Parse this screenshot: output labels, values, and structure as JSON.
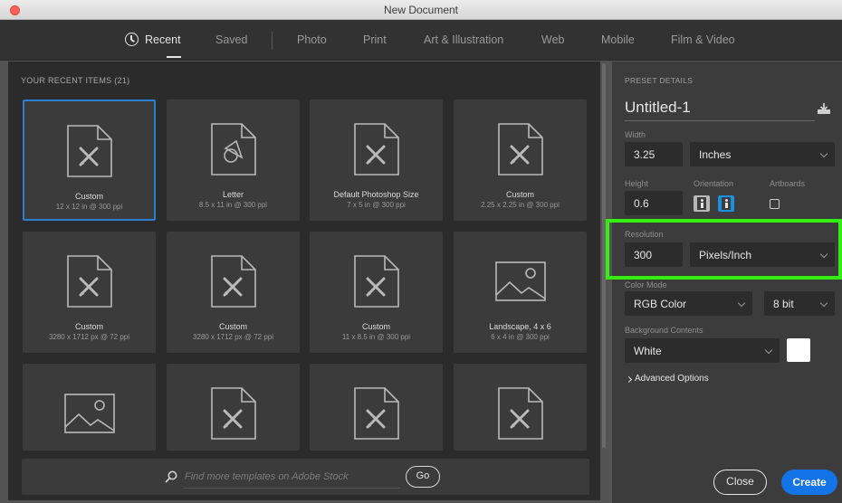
{
  "window": {
    "title": "New Document"
  },
  "nav": {
    "tabs": [
      {
        "label": "Recent",
        "active": true
      },
      {
        "label": "Saved"
      },
      {
        "label": "Photo"
      },
      {
        "label": "Print"
      },
      {
        "label": "Art & Illustration"
      },
      {
        "label": "Web"
      },
      {
        "label": "Mobile"
      },
      {
        "label": "Film & Video"
      }
    ]
  },
  "recent": {
    "heading": "YOUR RECENT ITEMS  (21)",
    "items": [
      {
        "name": "Custom",
        "desc": "12 x 12 in @ 300 ppi",
        "icon": "document-brush-icon",
        "selected": true
      },
      {
        "name": "Letter",
        "desc": "8.5 x 11 in @ 300 ppi",
        "icon": "document-shapes-icon"
      },
      {
        "name": "Default Photoshop Size",
        "desc": "7 x 5 in @ 300 ppi",
        "icon": "document-brush-icon"
      },
      {
        "name": "Custom",
        "desc": "2.25 x 2.25 in @ 300 ppi",
        "icon": "document-brush-icon"
      },
      {
        "name": "Custom",
        "desc": "3280 x 1712 px @ 72 ppi",
        "icon": "document-brush-icon"
      },
      {
        "name": "Custom",
        "desc": "3280 x 1712 px @ 72 ppi",
        "icon": "document-brush-icon"
      },
      {
        "name": "Custom",
        "desc": "11 x 8.5 in @ 300 ppi",
        "icon": "document-brush-icon"
      },
      {
        "name": "Landscape, 4 x 6",
        "desc": "6 x 4 in @ 300 ppi",
        "icon": "landscape-image-icon"
      },
      {
        "name": "",
        "desc": "",
        "icon": "landscape-image-icon"
      },
      {
        "name": "",
        "desc": "",
        "icon": "document-brush-icon"
      },
      {
        "name": "",
        "desc": "",
        "icon": "document-brush-icon"
      },
      {
        "name": "",
        "desc": "",
        "icon": "document-brush-icon"
      }
    ]
  },
  "search": {
    "placeholder": "Find more templates on Adobe Stock",
    "go_label": "Go"
  },
  "preset": {
    "heading": "PRESET DETAILS",
    "name": "Untitled-1",
    "width_label": "Width",
    "width_value": "3.25",
    "width_unit": "Inches",
    "height_label": "Height",
    "height_value": "0.6",
    "orientation_label": "Orientation",
    "artboards_label": "Artboards",
    "resolution_label": "Resolution",
    "resolution_value": "300",
    "resolution_unit": "Pixels/Inch",
    "color_mode_label": "Color Mode",
    "color_mode_value": "RGB Color",
    "bit_depth": "8 bit",
    "background_label": "Background Contents",
    "background_value": "White",
    "background_color": "#ffffff",
    "advanced_label": "Advanced Options"
  },
  "actions": {
    "close_label": "Close",
    "create_label": "Create"
  },
  "colors": {
    "accent": "#1473e6",
    "selection": "#2d7fd2",
    "highlight": "#33ee11"
  }
}
